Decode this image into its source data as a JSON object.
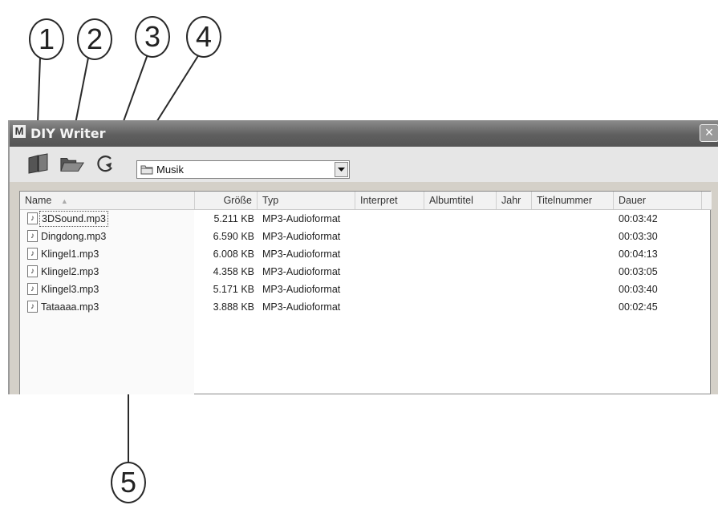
{
  "callouts": [
    "1",
    "2",
    "3",
    "4",
    "5"
  ],
  "window": {
    "app_icon_letter": "M",
    "title": "DIY Writer",
    "close_label": "×"
  },
  "toolbar": {
    "buttons": [
      {
        "icon": "book-icon"
      },
      {
        "icon": "open-folder-icon"
      },
      {
        "icon": "refresh-icon"
      }
    ],
    "folder_select": {
      "icon": "folder-icon",
      "value": "Musik"
    }
  },
  "list": {
    "columns": [
      "Name",
      "Größe",
      "Typ",
      "Interpret",
      "Albumtitel",
      "Jahr",
      "Titelnummer",
      "Dauer"
    ],
    "sort_indicator": "▲",
    "rows": [
      {
        "name": "3DSound.mp3",
        "size": "5.211 KB",
        "type": "MP3-Audioformat",
        "duration": "00:03:42"
      },
      {
        "name": "Dingdong.mp3",
        "size": "6.590 KB",
        "type": "MP3-Audioformat",
        "duration": "00:03:30"
      },
      {
        "name": "Klingel1.mp3",
        "size": "6.008 KB",
        "type": "MP3-Audioformat",
        "duration": "00:04:13"
      },
      {
        "name": "Klingel2.mp3",
        "size": "4.358 KB",
        "type": "MP3-Audioformat",
        "duration": "00:03:05"
      },
      {
        "name": "Klingel3.mp3",
        "size": "5.171 KB",
        "type": "MP3-Audioformat",
        "duration": "00:03:40"
      },
      {
        "name": "Tataaaa.mp3",
        "size": "3.888 KB",
        "type": "MP3-Audioformat",
        "duration": "00:02:45"
      }
    ],
    "file_icon_glyph": "♪"
  }
}
